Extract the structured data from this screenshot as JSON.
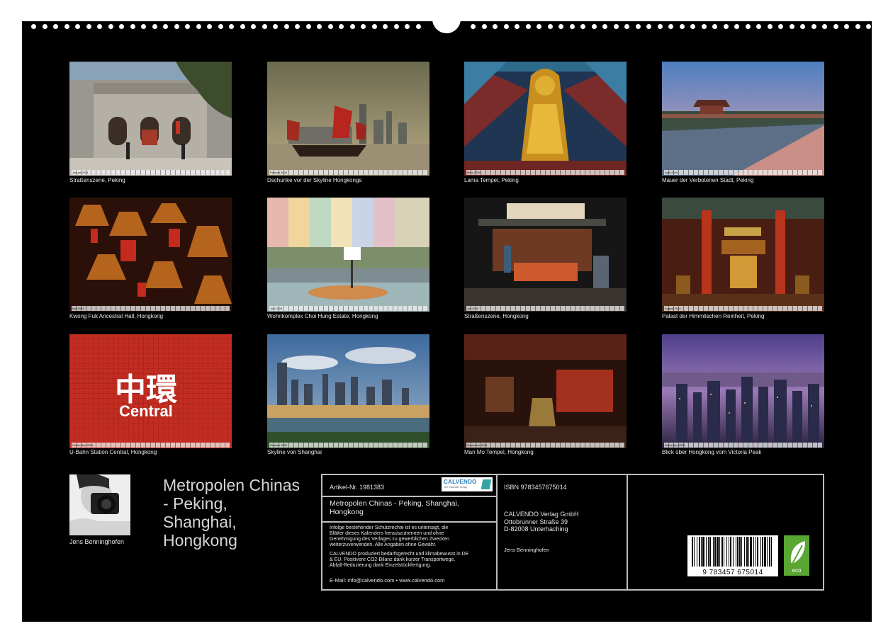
{
  "tiles": [
    {
      "caption": "Straßenszene, Peking",
      "month_label": "Januar 2024"
    },
    {
      "caption": "Dschunke vor der Skyline Hongkongs",
      "month_label": "Februar 2024"
    },
    {
      "caption": "Lama Tempel, Peking",
      "month_label": "März 2024"
    },
    {
      "caption": "Mauer der Verbotenen Stadt, Peking",
      "month_label": "April 2024"
    },
    {
      "caption": "Kwong Fuk Ancestral Hall, Hongkong",
      "month_label": "Mai 2024"
    },
    {
      "caption": "Wohnkomplex Choi Hung Estate, Hongkong",
      "month_label": "Juni 2024"
    },
    {
      "caption": "Straßenszene, Hongkong",
      "month_label": "Juli 2024"
    },
    {
      "caption": "Palast der Himmlischen Reinheit, Peking",
      "month_label": "August 2024"
    },
    {
      "caption": "U-Bahn Station Central, Hongkong",
      "month_label": "September 2024"
    },
    {
      "caption": "Skyline von Shanghai",
      "month_label": "Oktober 2024"
    },
    {
      "caption": "Man Mo Tempel, Hongkong",
      "month_label": "November 2024"
    },
    {
      "caption": "Blick über Hongkong vom Victoria Peak",
      "month_label": "Dezember 2024"
    }
  ],
  "station_sign": {
    "chinese": "中環",
    "latin": "Central"
  },
  "author": {
    "name": "Jens Benninghofen"
  },
  "title_lines": [
    "Metropolen Chinas",
    "- Peking,",
    "Shanghai,",
    "Hongkong"
  ],
  "info": {
    "article_no": "Artikel-Nr. 1981383",
    "logo_text": "CALVENDO",
    "logo_sub": "Der Kalender-Verlag",
    "product_title_1": "Metropolen Chinas - Peking, Shanghai,",
    "product_title_2": "Hongkong",
    "legal_1": [
      "Infolge bestehender Schutzrechte ist es untersagt, die",
      "Blätter dieses Kalenders herauszutrennen und ohne",
      "Genehmigung des Verlages zu gewerblichen Zwecken",
      "weiterzuverwenden. Alle Angaben ohne Gewähr."
    ],
    "legal_2": [
      "CALVENDO produziert bedarfsgerecht und klimabewusst in DE",
      "& EU. Positivere CO2-Bilanz dank kurzer Transportwege.",
      "Abfall-Reduzierung dank Einzelstückfertigung."
    ],
    "contact": "E-Mail: info@calvendo.com • www.calvendo.com",
    "isbn": "ISBN 9783457675014",
    "publisher": [
      "CALVENDO Verlag GmbH",
      "Ottobrunner Straße 39",
      "D-82008 Unterhaching"
    ],
    "author_small": "Jens Benninghofen",
    "barcode_digits": "9 783457 675014",
    "eco_label": "eco"
  }
}
